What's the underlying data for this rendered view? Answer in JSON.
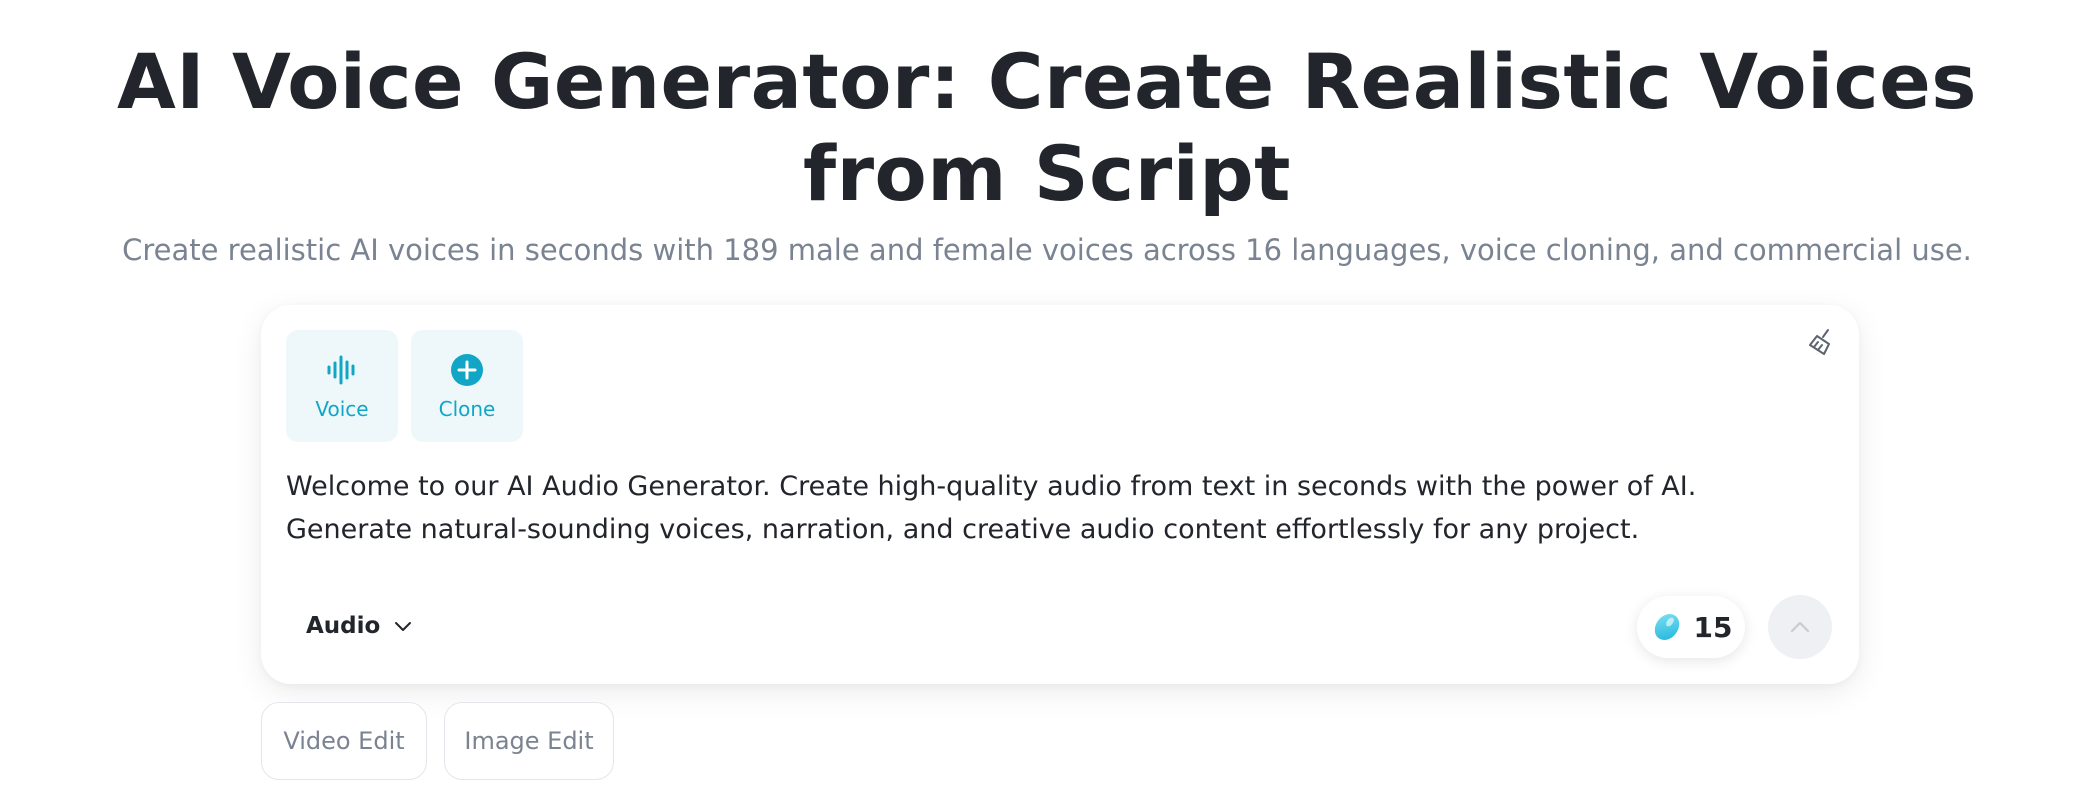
{
  "header": {
    "title": "AI Voice Generator: Create Realistic Voices from Script",
    "subtitle": "Create realistic AI voices in seconds with 189 male and female voices across 16 languages, voice cloning, and commercial use."
  },
  "editor": {
    "modes": [
      {
        "label": "Voice",
        "icon": "waveform-icon"
      },
      {
        "label": "Clone",
        "icon": "plus-circle-icon"
      }
    ],
    "clear_icon": "broom-icon",
    "prompt_text": "Welcome to our AI Audio Generator. Create high-quality audio from text in seconds with the power of AI. Generate natural-sounding voices, narration, and creative audio content effortlessly for any project.",
    "output_type": "Audio",
    "credits": "15",
    "credits_icon": "credit-gem-icon",
    "submit_icon": "chevron-up-icon"
  },
  "shortcuts": [
    "Video Edit",
    "Image Edit"
  ],
  "colors": {
    "accent": "#12a6c6",
    "tile_bg": "#eef8fb",
    "title": "#22252b",
    "muted": "#7a8391"
  }
}
